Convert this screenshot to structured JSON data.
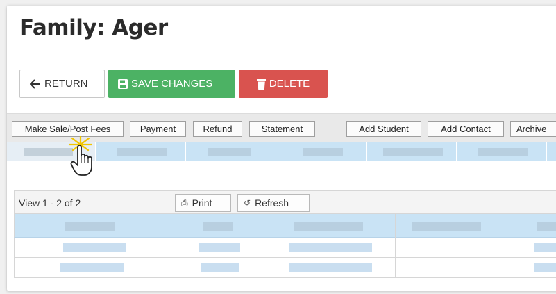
{
  "page": {
    "title": "Family: Ager"
  },
  "actions": {
    "return_label": "RETURN",
    "save_label": "SAVE CHANGES",
    "delete_label": "DELETE",
    "save_color": "#4cb264",
    "delete_color": "#d9534f"
  },
  "toolbar": {
    "items": [
      {
        "label": "Make Sale/Post Fees"
      },
      {
        "label": "Payment"
      },
      {
        "label": "Refund"
      },
      {
        "label": "Statement"
      },
      {
        "label": "Add Student"
      },
      {
        "label": "Add Contact"
      },
      {
        "label": "Archive"
      }
    ]
  },
  "grid": {
    "view_count": "View 1 - 2 of 2",
    "print_label": "Print",
    "refresh_label": "Refresh"
  },
  "icons": {
    "return": "arrow-left-icon",
    "save": "floppy-disk-icon",
    "delete": "trash-icon",
    "print": "printer-icon",
    "refresh": "refresh-icon",
    "cursor": "hand-pointer-icon"
  }
}
